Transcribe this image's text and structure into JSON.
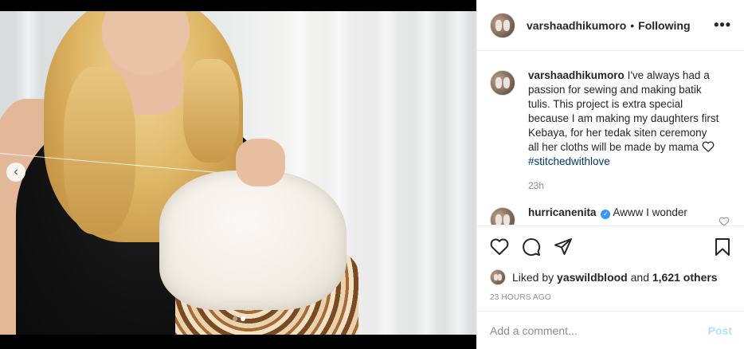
{
  "post": {
    "username": "varshaadhikumoro",
    "separator": "•",
    "follow_status": "Following",
    "more_icon": "more-horizontal-icon",
    "caption": {
      "username": "varshaadhikumoro",
      "text": "I've always had a passion for sewing and making batik tulis. This project is extra special because I am making my daughters first Kebaya, for her tedak siten ceremony all her cloths will be made by mama",
      "hashtag": "#stitchedwithlove",
      "time": "23h"
    },
    "comments": [
      {
        "username": "hurricanenita",
        "verified": true,
        "text": "Awww I wonder"
      }
    ],
    "likes": {
      "prefix": "Liked by",
      "liked_by": "yaswildblood",
      "and": "and",
      "others": "1,621 others"
    },
    "timestamp": "23 HOURS AGO",
    "add_comment": {
      "placeholder": "Add a comment...",
      "post_label": "Post"
    }
  },
  "media": {
    "carousel_total": 2,
    "carousel_active": 1
  },
  "colors": {
    "link": "#00376b",
    "post_disabled": "#b2dffc",
    "muted": "#8e8e8e",
    "verified": "#3897f0"
  }
}
